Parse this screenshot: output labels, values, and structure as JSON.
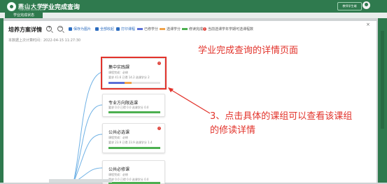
{
  "header": {
    "brand": "燕山大学",
    "brand_sub": "YANSHAN UNIVERSITY",
    "app_title": "学业完成查询",
    "user_button": "教师学生端",
    "tab_label": "学业完成状态"
  },
  "modal": {
    "title": "培养方案详情",
    "close": "×",
    "toolbar": [
      "保存为图片",
      "全部收起",
      "打印课程"
    ],
    "legend": [
      "已修学分",
      "选课学分",
      "修读完成",
      "当前选课学年学期可选课程数"
    ],
    "updated": "本数据上次计算时间：2022-04-15 11:27:30"
  },
  "cards": [
    {
      "name": "集中实践課",
      "meta": "课程完成：必修",
      "stats": "要求 41.6   已得 14.2   选课学分 2"
    },
    {
      "name": "专业方向限选课",
      "meta": "",
      "stats": "要求 0.0   已得 0.0   选课学分 0.0"
    },
    {
      "name": "公共必选课",
      "meta": "课程完成：必修",
      "stats": "要求 23.9   已得 23.9   选课学分 1.4"
    },
    {
      "name": "公共必修课",
      "meta": "课程完成：必修",
      "stats": "要求 0.0   已得 0.0   选课学分 0.0"
    }
  ],
  "card_progress": [
    0.45,
    1.0,
    1.0,
    1.0
  ],
  "annotations": {
    "detail_page": "学业完成查询的详情页面",
    "step3_line1": "3、点击具体的课组可以查看该课组",
    "step3_line2": "的修读详情"
  },
  "colors": {
    "brand_green": "#2f7a4e",
    "completed_green": "#4caf50",
    "earned_blue": "#5b6fd6",
    "selected_orange": "#f0a34a",
    "annotation_red": "#e2332b"
  }
}
